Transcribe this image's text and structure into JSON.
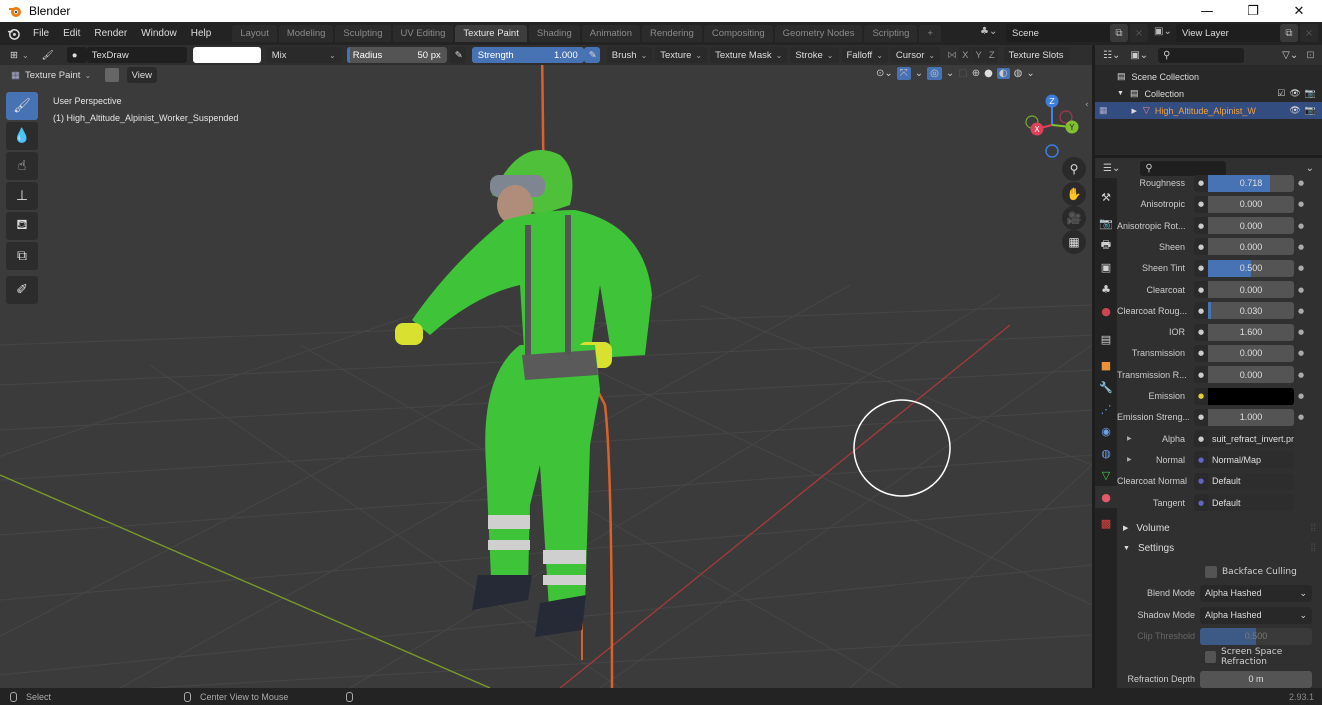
{
  "window": {
    "title": "Blender",
    "icons": {
      "logo": "blender-logo-icon",
      "minimize": "minimize-icon",
      "maximize": "maximize-icon",
      "close": "close-icon"
    }
  },
  "menu": [
    "File",
    "Edit",
    "Render",
    "Window",
    "Help"
  ],
  "workspaces": [
    {
      "label": "Layout",
      "active": false
    },
    {
      "label": "Modeling",
      "active": false
    },
    {
      "label": "Sculpting",
      "active": false
    },
    {
      "label": "UV Editing",
      "active": false
    },
    {
      "label": "Texture Paint",
      "active": true
    },
    {
      "label": "Shading",
      "active": false
    },
    {
      "label": "Animation",
      "active": false
    },
    {
      "label": "Rendering",
      "active": false
    },
    {
      "label": "Compositing",
      "active": false
    },
    {
      "label": "Geometry Nodes",
      "active": false
    },
    {
      "label": "Scripting",
      "active": false
    }
  ],
  "add_workspace": "+",
  "scene": {
    "name": "Scene",
    "view_layer": "View Layer"
  },
  "tool_header": {
    "brush_name": "TexDraw",
    "color_hex": "#ffffff",
    "blend": "Mix",
    "radius_label": "Radius",
    "radius_value": "50 px",
    "strength_label": "Strength",
    "strength_value": "1.000",
    "strength_fraction": 1.0,
    "dropdowns": [
      "Brush",
      "Texture",
      "Texture Mask",
      "Stroke",
      "Falloff",
      "Cursor"
    ],
    "axes": [
      "X",
      "Y",
      "Z"
    ],
    "texture_slots": "Texture Slots"
  },
  "mode": {
    "label": "Texture Paint",
    "view": "View"
  },
  "viewport": {
    "perspective": "User Perspective",
    "object": "(1) High_Altitude_Alpinist_Worker_Suspended",
    "gizmo": {
      "x": "X",
      "y": "Y",
      "z": "Z"
    }
  },
  "tools": [
    "brush-draw-icon",
    "soften-icon",
    "smear-icon",
    "clone-icon",
    "fill-icon",
    "mask-icon",
    "annotate-icon"
  ],
  "outliner": {
    "rows": [
      {
        "label": "Scene Collection",
        "indent": 0
      },
      {
        "label": "Collection",
        "indent": 1
      },
      {
        "label": "High_Altitude_Alpinist_W",
        "indent": 2,
        "selected": true
      }
    ]
  },
  "properties": {
    "rows": [
      {
        "label": "Roughness",
        "value": "0.718",
        "fraction": 0.718,
        "keyframe": true
      },
      {
        "label": "Anisotropic",
        "value": "0.000",
        "fraction": 0,
        "keyframe": true
      },
      {
        "label": "Anisotropic Rot...",
        "value": "0.000",
        "fraction": 0,
        "keyframe": true
      },
      {
        "label": "Sheen",
        "value": "0.000",
        "fraction": 0,
        "keyframe": true
      },
      {
        "label": "Sheen Tint",
        "value": "0.500",
        "fraction": 0.5,
        "keyframe": true
      },
      {
        "label": "Clearcoat",
        "value": "0.000",
        "fraction": 0,
        "keyframe": true
      },
      {
        "label": "Clearcoat Roug...",
        "value": "0.030",
        "fraction": 0.03,
        "keyframe": true
      },
      {
        "label": "IOR",
        "value": "1.600",
        "fraction": 0,
        "keyframe": true
      },
      {
        "label": "Transmission",
        "value": "0.000",
        "fraction": 0,
        "keyframe": true
      },
      {
        "label": "Transmission R...",
        "value": "0.000",
        "fraction": 0,
        "keyframe": true
      },
      {
        "label": "Emission",
        "value": "",
        "color": "#000000",
        "socket": "yellow",
        "keyframe": true
      },
      {
        "label": "Emission Streng...",
        "value": "1.000",
        "fraction": 0,
        "keyframe": true
      },
      {
        "label": "Alpha",
        "value": "suit_refract_invert.pn",
        "link": true,
        "expand": true
      },
      {
        "label": "Normal",
        "value": "Normal/Map",
        "link": true,
        "socket": "purple",
        "expand": true
      },
      {
        "label": "Clearcoat Normal",
        "value": "Default",
        "link": true,
        "socket": "purple"
      },
      {
        "label": "Tangent",
        "value": "Default",
        "link": true,
        "socket": "purple"
      }
    ],
    "sections": {
      "volume": "Volume",
      "settings": "Settings"
    },
    "settings": {
      "backface_culling": "Backface Culling",
      "blend_mode_label": "Blend Mode",
      "blend_mode": "Alpha Hashed",
      "shadow_mode_label": "Shadow Mode",
      "shadow_mode": "Alpha Hashed",
      "clip_threshold_label": "Clip Threshold",
      "clip_threshold": "0.500",
      "clip_fraction": 0.5,
      "ssr_label": "Screen Space Refraction",
      "refraction_depth_label": "Refraction Depth",
      "refraction_depth": "0 m"
    }
  },
  "statusbar": {
    "select": "Select",
    "center": "Center View to Mouse",
    "version": "2.93.1"
  }
}
